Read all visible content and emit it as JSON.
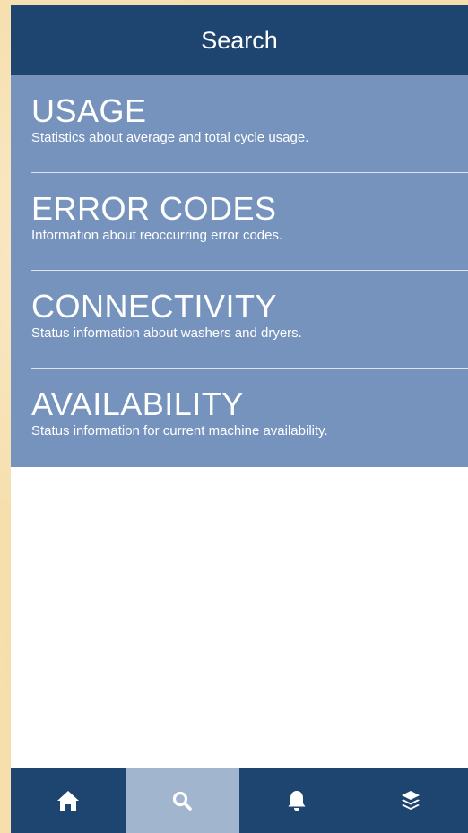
{
  "header": {
    "title": "Search"
  },
  "menu": {
    "items": [
      {
        "title": "USAGE",
        "description": "Statistics about average and total cycle usage."
      },
      {
        "title": "ERROR CODES",
        "description": "Information about reoccurring error codes."
      },
      {
        "title": "CONNECTIVITY",
        "description": "Status information about washers and dryers."
      },
      {
        "title": "AVAILABILITY",
        "description": "Status information for current machine availability."
      }
    ]
  },
  "tabbar": {
    "tabs": [
      {
        "icon": "home-icon",
        "active": false
      },
      {
        "icon": "search-icon",
        "active": true
      },
      {
        "icon": "bell-icon",
        "active": false
      },
      {
        "icon": "layers-icon",
        "active": false
      }
    ]
  },
  "colors": {
    "header": "#1e4470",
    "menu_background": "#7593bd",
    "active_tab": "#a2b5cf",
    "page_background": "#ffffff",
    "outer_background": "#f6dfad"
  }
}
